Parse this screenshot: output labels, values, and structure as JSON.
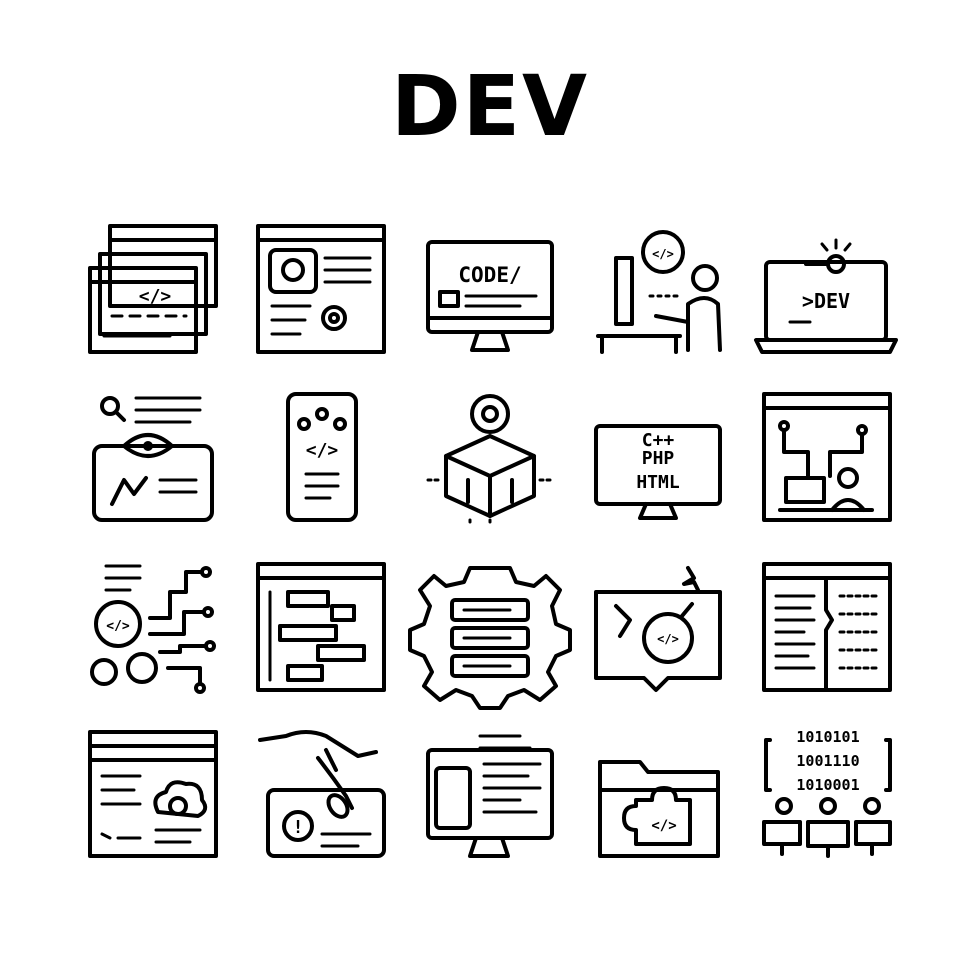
{
  "page": {
    "title": "DEV"
  },
  "icons": [
    {
      "name": "browser-windows-code-icon",
      "text": "</>"
    },
    {
      "name": "document-support-settings-icon",
      "text": ""
    },
    {
      "name": "monitor-code-icon",
      "text": "CODE/"
    },
    {
      "name": "developer-at-computer-icon",
      "text": "</>"
    },
    {
      "name": "laptop-dev-key-icon",
      "text": ">DEV"
    },
    {
      "name": "tablet-analytics-eye-icon",
      "text": ""
    },
    {
      "name": "smartphone-code-icon",
      "text": "</>"
    },
    {
      "name": "cube-gear-upload-icon",
      "text": ""
    },
    {
      "name": "monitor-languages-icon",
      "lines": [
        "C++",
        "PHP",
        "HTML"
      ]
    },
    {
      "name": "developer-circuit-board-icon",
      "text": ""
    },
    {
      "name": "gears-circuit-code-icon",
      "text": "</>"
    },
    {
      "name": "window-block-diagram-icon",
      "text": ""
    },
    {
      "name": "server-gear-icon",
      "text": ""
    },
    {
      "name": "message-bomb-icon",
      "text": "</>"
    },
    {
      "name": "split-code-document-icon",
      "text": ""
    },
    {
      "name": "window-cloud-icon",
      "text": ""
    },
    {
      "name": "hand-bug-alert-icon",
      "text": "!"
    },
    {
      "name": "monitor-phone-code-icon",
      "text": ""
    },
    {
      "name": "folder-puzzle-code-icon",
      "text": "</>"
    },
    {
      "name": "binary-team-icon",
      "lines": [
        "1010101",
        "1001110",
        "1010001"
      ]
    }
  ]
}
